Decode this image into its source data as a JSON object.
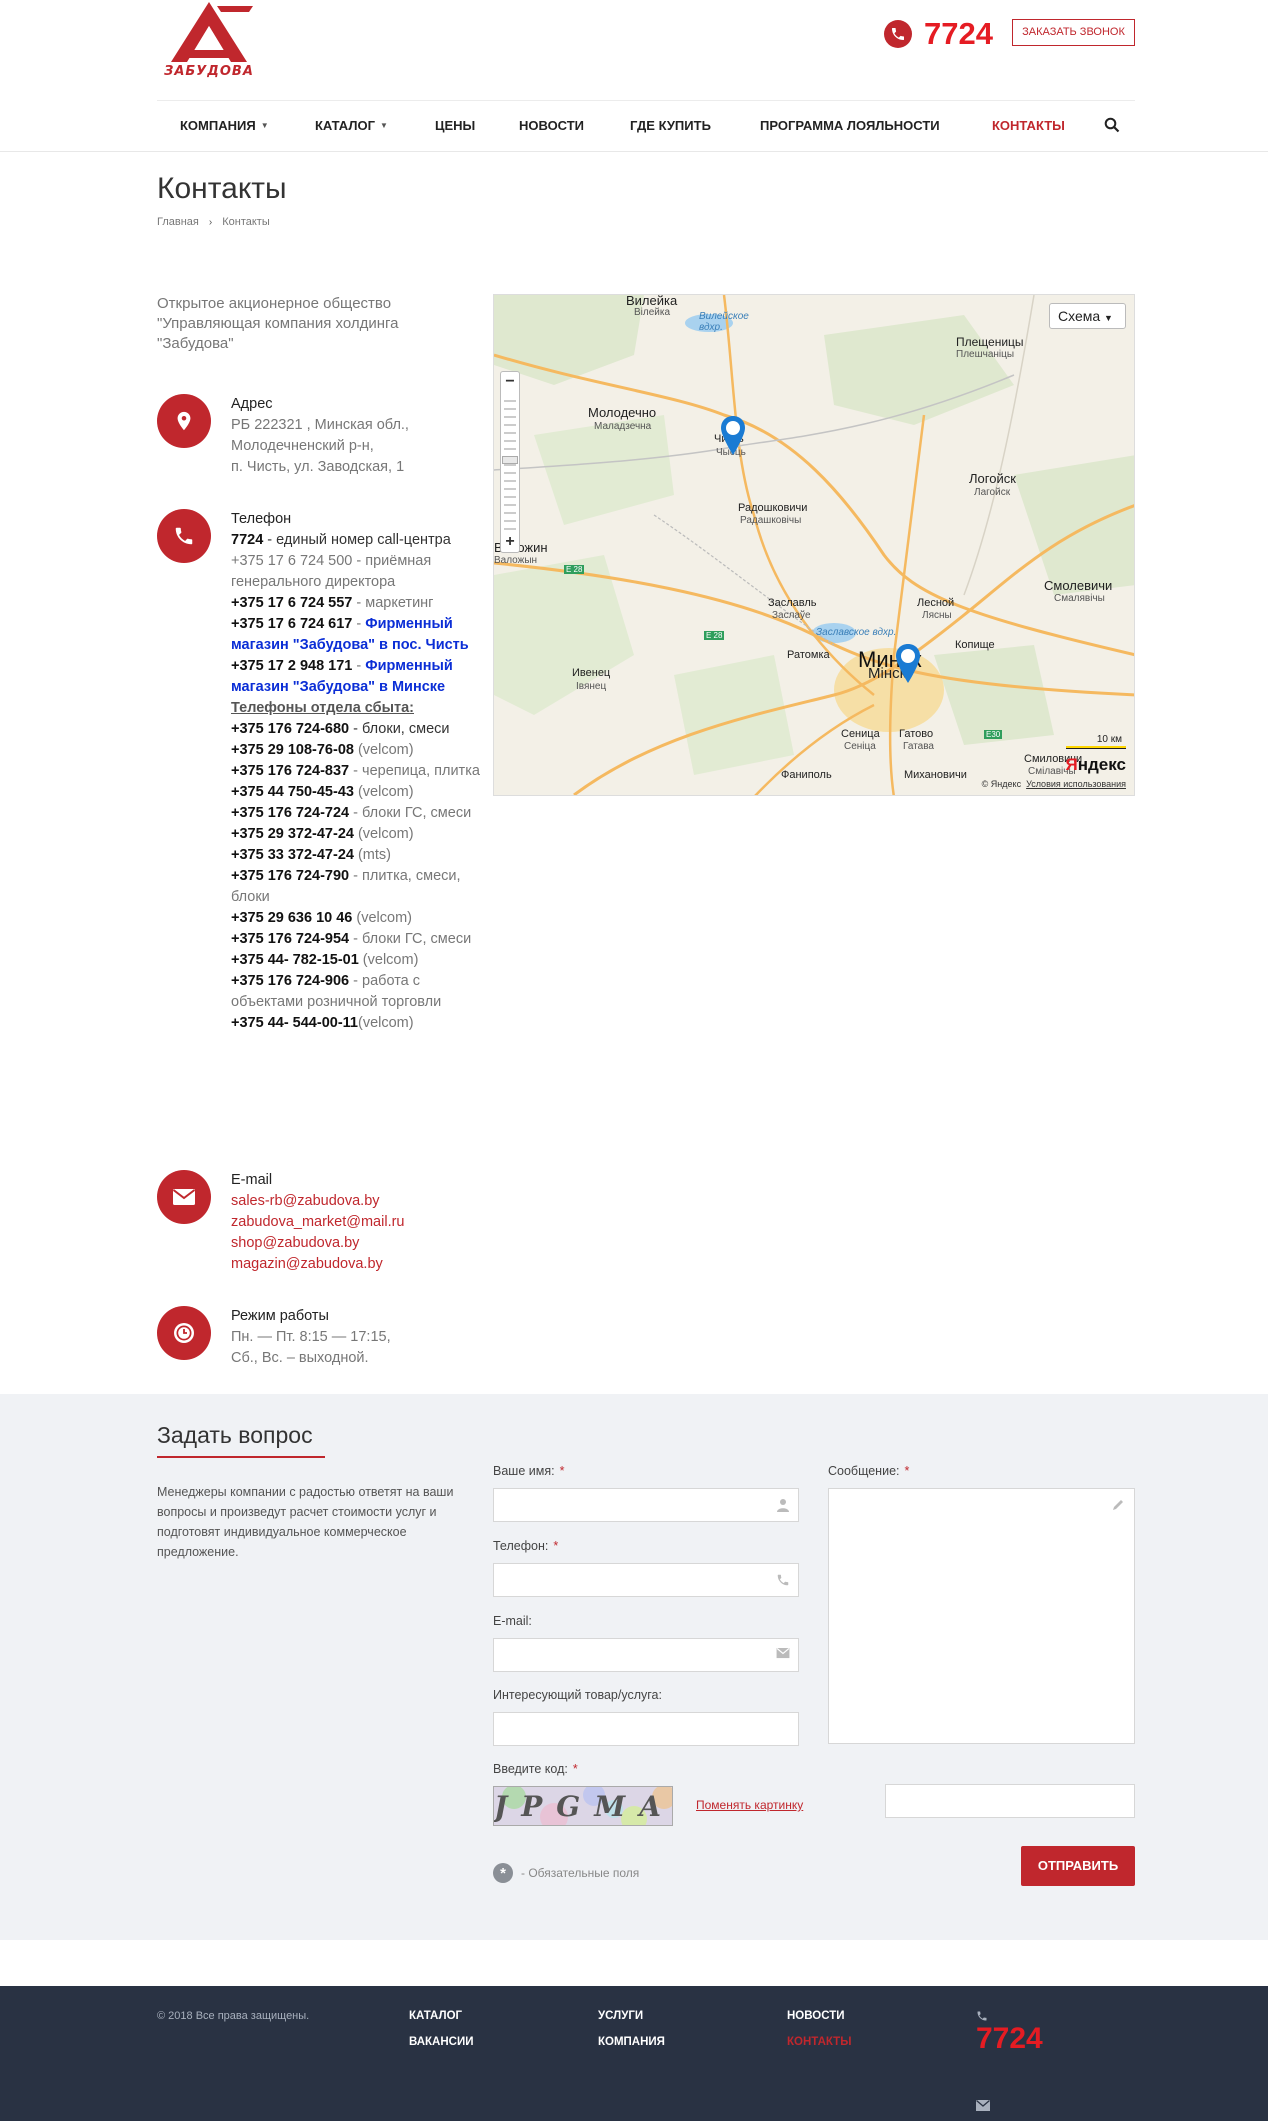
{
  "header": {
    "logo_text": "ЗАБУДОВА",
    "phone": "7724",
    "callback_label": "ЗАКАЗАТЬ ЗВОНОК",
    "nav": [
      {
        "label": "КОМПАНИЯ",
        "caret": true
      },
      {
        "label": "КАТАЛОГ",
        "caret": true
      },
      {
        "label": "ЦЕНЫ"
      },
      {
        "label": "НОВОСТИ"
      },
      {
        "label": "ГДЕ КУПИТЬ"
      },
      {
        "label": "ПРОГРАММА ЛОЯЛЬНОСТИ"
      },
      {
        "label": "КОНТАКТЫ",
        "active": true
      }
    ]
  },
  "page": {
    "title": "Контакты",
    "breadcrumb": [
      "Главная",
      "Контакты"
    ]
  },
  "contacts": {
    "company": "Открытое акционерное общество \"Управляющая компания холдинга \"Забудова\"",
    "address": {
      "title": "Адрес",
      "lines": [
        "РБ 222321 , Минская обл.,",
        "Молодечненский р-н,",
        "п. Чисть, ул. Заводская, 1"
      ]
    },
    "phone": {
      "title": "Телефон",
      "entries": [
        {
          "num": "7724",
          "desc": " - единый номер call-центра"
        },
        {
          "num": "+375 17 6 724 500",
          "desc": " - приёмная генерального директора",
          "plain": true
        },
        {
          "num": "+375 17 6 724 557",
          "desc": " - маркетинг"
        },
        {
          "num": "+375 17 6 724 617",
          "desc": " - ",
          "blue": "Фирменный магазин \"Забудова\" в  пос. Чисть"
        },
        {
          "num": "+375 17 2 948 171",
          "desc": " - ",
          "blue": "Фирменный магазин \"Забудова\" в Минске"
        }
      ],
      "sales_title": "Телефоны отдела сбыта:",
      "sales": [
        {
          "num": "+375 176 724-680",
          "desc": " - блоки, смеси"
        },
        {
          "num": "+375 29 108-76-08",
          "desc": " (velcom)"
        },
        {
          "num": "+375 176 724-837",
          "desc": " - черепица, плитка"
        },
        {
          "num": "+375 44 750-45-43",
          "desc": " (velcom)"
        },
        {
          "num": "+375 176 724-724",
          "desc": " - блоки ГС, смеси"
        },
        {
          "num": "+375 29 372-47-24",
          "desc": " (velcom)"
        },
        {
          "num": "+375 33 372-47-24",
          "desc": " (mts)"
        },
        {
          "num": "+375 176 724-790",
          "desc": " - плитка, смеси, блоки"
        },
        {
          "num": "+375 29 636 10 46",
          "desc": " (velcom)"
        },
        {
          "num": "+375 176 724-954",
          "desc": " - блоки ГС, смеси"
        },
        {
          "num": "+375 44- 782-15-01",
          "desc": " (velcom)"
        },
        {
          "num": "+375 176 724-906",
          "desc": " - работа с объектами розничной торговли"
        },
        {
          "num": "+375 44- 544-00-11",
          "desc": "(velcom)"
        }
      ]
    },
    "email": {
      "title": "E-mail",
      "items": [
        "sales-rb@zabudova.by",
        "zabudova_market@mail.ru",
        "shop@zabudova.by",
        "magazin@zabudova.by"
      ]
    },
    "hours": {
      "title": "Режим работы",
      "lines": [
        "Пн. — Пт. 8:15 — 17:15,",
        "Сб., Вс. – выходной."
      ]
    }
  },
  "map": {
    "type_button": "Схема",
    "labels": {
      "vileika": "Вилейка",
      "vileika_sub": "Вілейка",
      "reservoir": "Вилейское вдхр.",
      "pleshenitsy": "Плещеницы",
      "pleshenitsy_sub": "Плешчаніцы",
      "molodechno": "Молодечно",
      "molodechno_sub": "Маладзечна",
      "chist": "Чисть",
      "chist_sub": "Чысць",
      "logoisk": "Логойск",
      "logoisk_sub": "Лагойск",
      "radoshkovichi": "Радошковичи",
      "radoshkovichi_sub": "Радашковічы",
      "zaslavl": "Заславль",
      "zaslavl_sub": "Заслаўе",
      "lesnoy": "Лесной",
      "lesnoy_sub": "Лясны",
      "smolevichi": "Смолевичи",
      "smolevichi_sub": "Смалявічы",
      "volozhin": "Воложин",
      "volozhin_sub": "Валожын",
      "ivenets": "Ивенец",
      "ivenets_sub": "Івянец",
      "ratomka": "Ратомка",
      "kopishche": "Копище",
      "minsk": "Минск",
      "minsk_sub": "Мінск",
      "zaslav_reservoir": "Заславское вдхр.",
      "senitsa": "Сеница",
      "senitsa_sub": "Сеніца",
      "gatovo": "Гатово",
      "gatovo_sub": "Гатава",
      "fanipol": "Фаниполь",
      "mikhanovichi": "Михановичи",
      "smilovichi": "Смиловичи",
      "smilovichi_sub": "Смілавічы",
      "e28a": "E 28",
      "e28b": "E 28",
      "e30": "E30"
    },
    "scale": "10 км",
    "logo_y": "Я",
    "logo_rest": "ндекс",
    "copyright": "© Яндекс",
    "terms": "Условия использования"
  },
  "form": {
    "title": "Задать вопрос",
    "description": "Менеджеры компании с радостью ответят на ваши вопросы и произведут расчет стоимости услуг и подготовят индивидуальное коммерческое предложение.",
    "name_label": "Ваше имя:",
    "phone_label": "Телефон:",
    "email_label": "E-mail:",
    "product_label": "Интересующий товар/услуга:",
    "message_label": "Сообщение:",
    "captcha_label": "Введите код:",
    "captcha_text": "JPGMA",
    "change_picture": "Поменять картинку",
    "required_note": "- Обязательные поля",
    "required_mark": "*",
    "submit_label": "ОТПРАВИТЬ"
  },
  "footer": {
    "copyright": "© 2018 Все права защищены.",
    "links": [
      "КАТАЛОГ",
      "ВАКАНСИИ",
      "УСЛУГИ",
      "КОМПАНИЯ",
      "НОВОСТИ",
      "КОНТАКТЫ"
    ],
    "phone": "7724"
  },
  "colors": {
    "brand": "#c0272d",
    "phone": "#e51c23",
    "footer_bg": "#293243",
    "form_bg": "#f0f2f5"
  }
}
